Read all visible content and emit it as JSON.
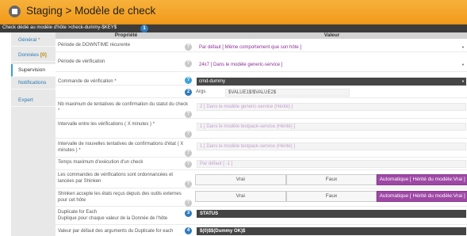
{
  "header": {
    "title": "Staging > Modèle de check"
  },
  "breadcrumb": {
    "text": "Check dédié au modèle d'hôte >check-dummy-$KEY$",
    "step": "1"
  },
  "sidebar": {
    "tabs": [
      {
        "label": "Général",
        "mark": "*"
      },
      {
        "label": "Données",
        "count": "[0]"
      },
      {
        "label": "Supervision"
      },
      {
        "label": "Notifications"
      },
      {
        "label": "Expert"
      }
    ]
  },
  "table": {
    "col_property": "Propriété",
    "col_value": "Valeur"
  },
  "rows": {
    "downtime": {
      "label": "Période de DOWNTIME récurente",
      "value": "Par défaut [ Même comportement que son hôte ]"
    },
    "check_period": {
      "label": "Période de vérification",
      "value": "24x7 [ Dans le modèle generic-service ]"
    },
    "check_command": {
      "label": "Commande de vérification *",
      "value": "cmd-dummy"
    },
    "args": {
      "step": "2",
      "label": "Args",
      "value": "$VALUE1$!$VALUE2$"
    },
    "max_attempts": {
      "label": "Nb maximum de tentatives de confirmation du statut du check *",
      "value": "2 [ Dans le modèle generic-service (Hérité) ]"
    },
    "check_interval": {
      "label": "Intervalle entre les vérifications ( X minutes ) *",
      "value": "1 [ Dans le modèle testpack-service (Hérité) ]"
    },
    "retry_interval": {
      "label": "Intervalle de nouvelles tentatives de confirmations d'état ( X minutes ) *",
      "value": "1 [ Dans le modèle testpack-service (Hérité) ]"
    },
    "timeout": {
      "label": "Temps maximum d'exécution d'un check",
      "value": "Par défaut [ -1 ]"
    },
    "active_checks": {
      "label": "Les commandes de vérifications sont ordonnancées et lancées par Shinken",
      "options": [
        "Vrai",
        "Faux",
        "Automatique [ Hérité du modèle:Vrai ]"
      ]
    },
    "passive_checks": {
      "label": "Shinken accepte les états reçus depuis des outils externes pour cet hôte",
      "options": [
        "Vrai",
        "Faux",
        "Automatique [ Hérité du modèle:Vrai ]"
      ]
    },
    "duplicate_for_each": {
      "step": "3",
      "label": "Duplicate for Each",
      "sublabel": "Duplique pour chaque valeur de la Donnée de l'hôte",
      "value": "STATUS"
    },
    "duplicate_default": {
      "step": "4",
      "label": "Valeur par défaut des arguments du Duplicate for each",
      "value": "$(0)$$(Dummy OK)$"
    }
  },
  "icons": {
    "logo": "shinken-logo-icon",
    "help": "help-icon",
    "caret": "caret-down-icon"
  },
  "colors": {
    "header": "#f29a1a",
    "accent_purple": "#9e48a5",
    "badge_blue": "#2f7bbf",
    "dark_field": "#444444"
  }
}
